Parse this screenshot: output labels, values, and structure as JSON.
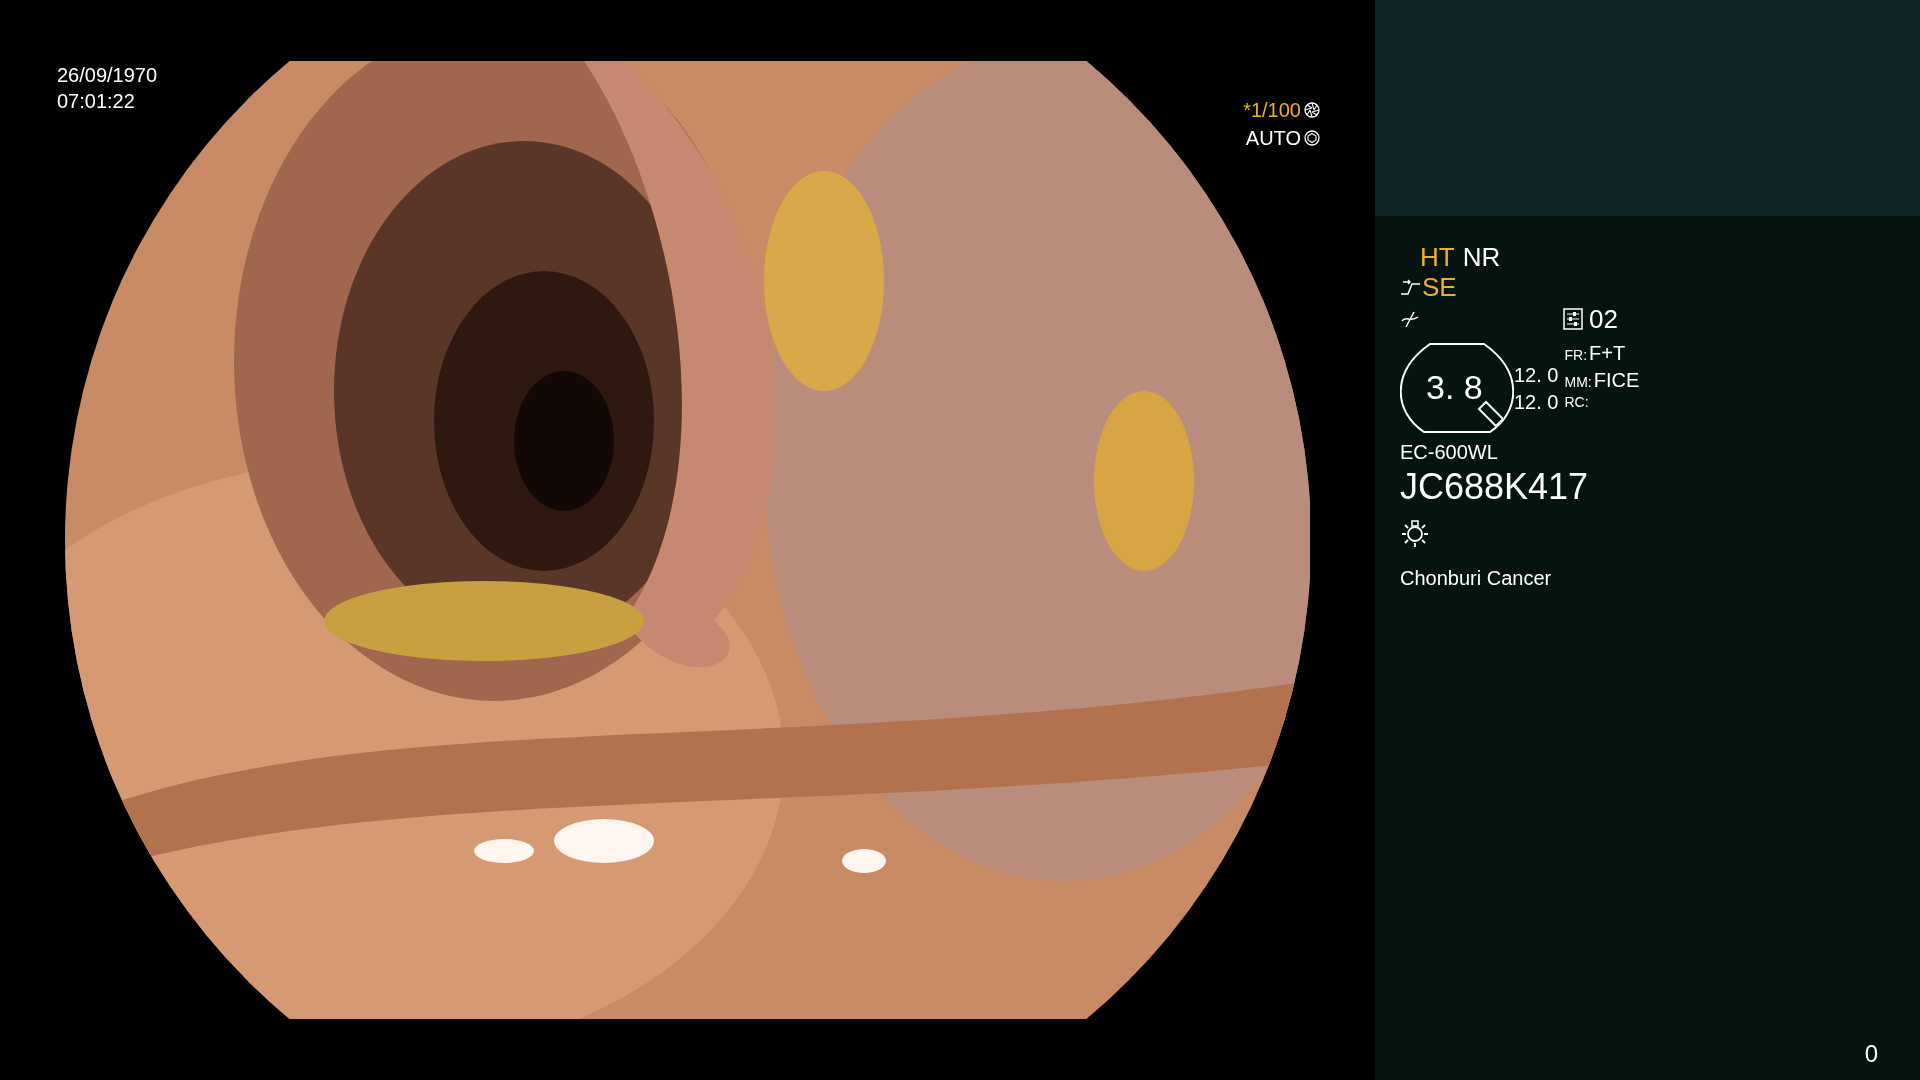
{
  "image_overlay": {
    "date": "26/09/1970",
    "time": "07:01:22",
    "exposure": [
      {
        "text": "*1/100",
        "active": true
      },
      {
        "text": "AUTO",
        "active": false
      }
    ]
  },
  "status_panel": {
    "modes": [
      {
        "label": "HT",
        "active": true
      },
      {
        "label": "NR",
        "active": false
      }
    ],
    "enhancement": {
      "label": "SE",
      "active": true
    },
    "preset": "02",
    "zoom": "3. 8",
    "readings": [
      "12. 0",
      "12. 0"
    ],
    "settings": [
      {
        "key": "FR:",
        "value": "F+T"
      },
      {
        "key": "MM:",
        "value": "FICE"
      },
      {
        "key": "RC:"
      }
    ],
    "scope_model": "EC-600WL",
    "scope_serial": "JC688K417",
    "institution": "Chonburi Cancer"
  },
  "counter": "0"
}
